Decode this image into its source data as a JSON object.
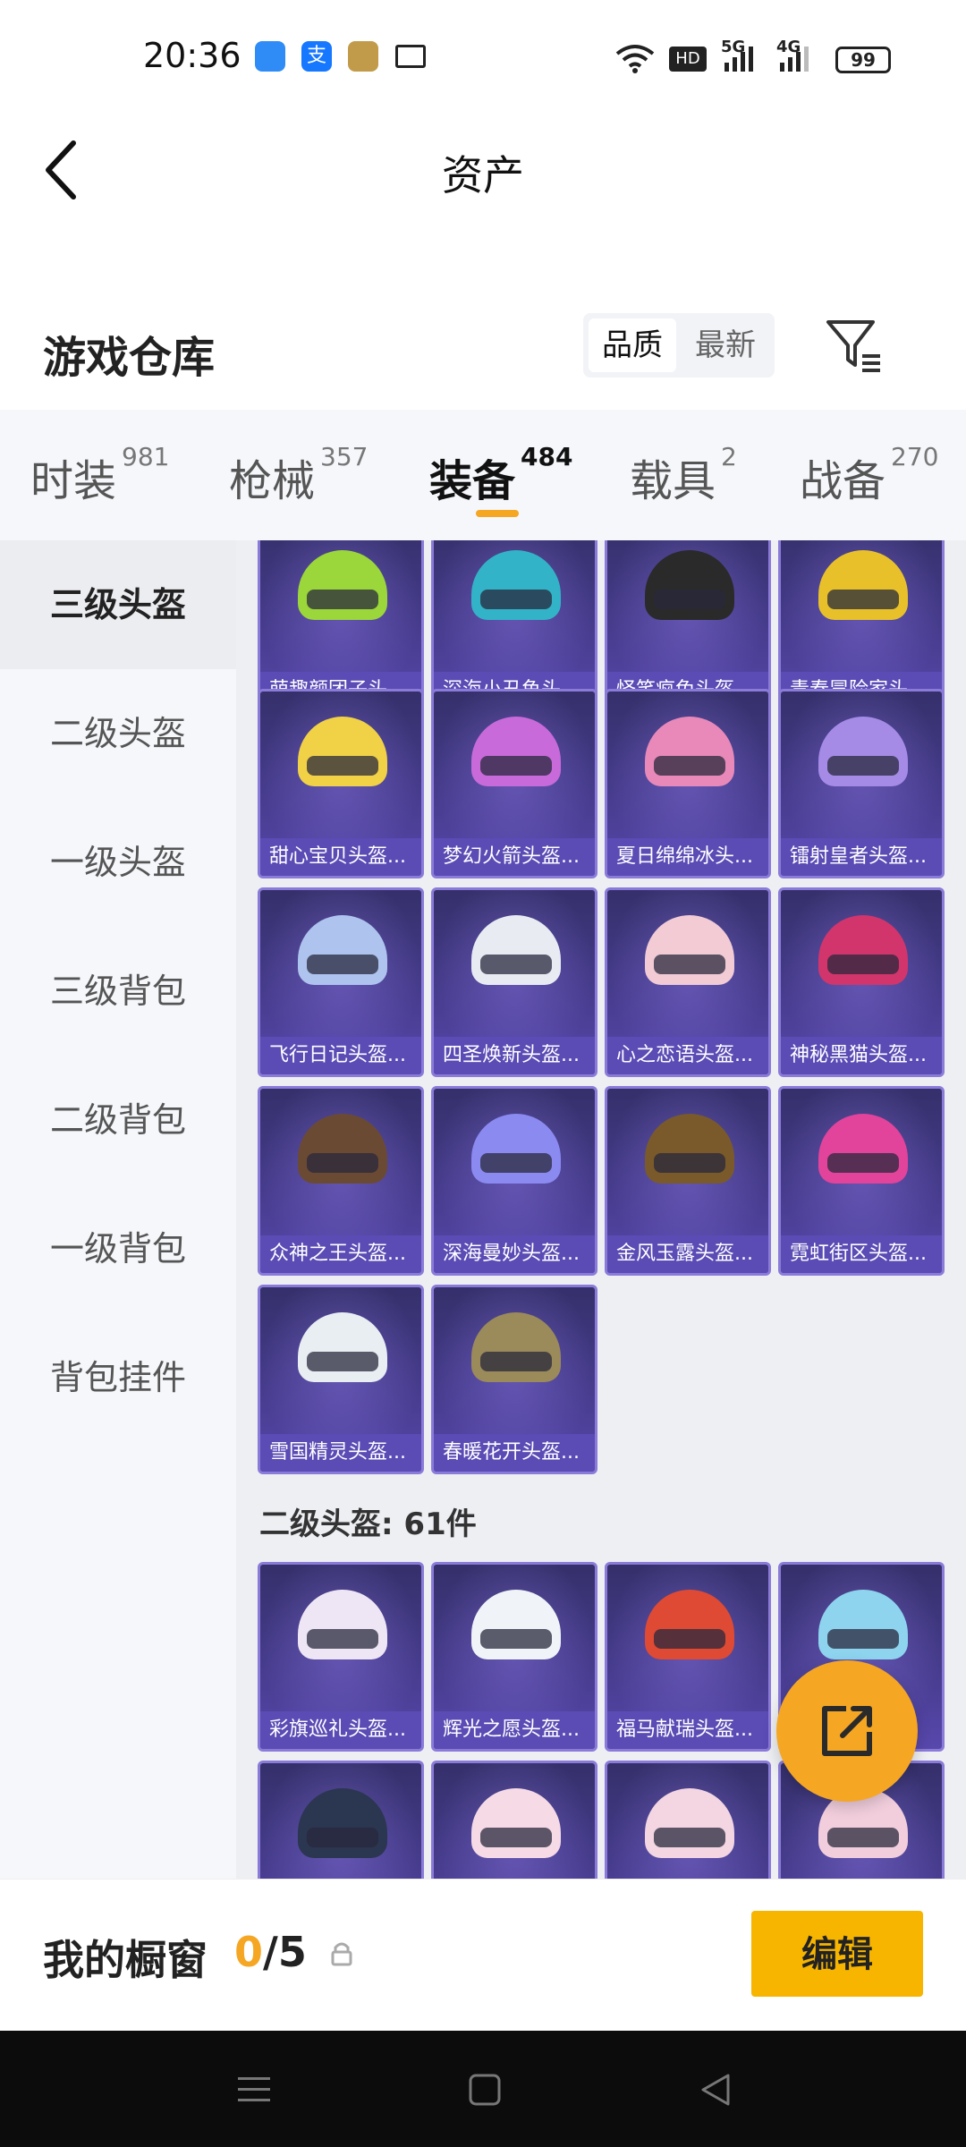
{
  "status_bar": {
    "time": "20:36",
    "icons": [
      "app-icon-blue",
      "alipay-icon",
      "game-app-icon",
      "mail-icon",
      "wifi-icon",
      "hd-icon",
      "5g-signal-icon",
      "4g-signal-icon"
    ],
    "network_5g": "5G",
    "network_4g": "4G",
    "hd": "HD",
    "battery": "99"
  },
  "header": {
    "title": "资产",
    "back_icon": "back-arrow-icon"
  },
  "section": {
    "title": "游戏仓库",
    "sort_options": [
      "品质",
      "最新"
    ],
    "sort_selected": "品质",
    "filter_icon": "filter-icon"
  },
  "tabs": [
    {
      "label": "时装",
      "count": "981"
    },
    {
      "label": "枪械",
      "count": "357"
    },
    {
      "label": "装备",
      "count": "484",
      "active": true
    },
    {
      "label": "载具",
      "count": "2"
    },
    {
      "label": "战备",
      "count": "270"
    }
  ],
  "sidebar": {
    "items": [
      "三级头盔",
      "二级头盔",
      "一级头盔",
      "三级背包",
      "二级背包",
      "一级背包",
      "背包挂件"
    ],
    "active": "三级头盔"
  },
  "items_level3": [
    {
      "name": "萌趣颜团子头...",
      "color": "#9bd63a"
    },
    {
      "name": "深海小丑鱼头...",
      "color": "#33b3c7"
    },
    {
      "name": "怪笑疯兔头盔...",
      "color": "#2a2a2a"
    },
    {
      "name": "青春冒险家头...",
      "color": "#e8c12a"
    },
    {
      "name": "甜心宝贝头盔...",
      "color": "#f1d146"
    },
    {
      "name": "梦幻火箭头盔...",
      "color": "#c86ad9"
    },
    {
      "name": "夏日绵绵冰头...",
      "color": "#e889b9"
    },
    {
      "name": "镭射皇者头盔...",
      "color": "#a58be6"
    },
    {
      "name": "飞行日记头盔...",
      "color": "#aec4ee"
    },
    {
      "name": "四圣焕新头盔...",
      "color": "#e8ecf2"
    },
    {
      "name": "心之恋语头盔...",
      "color": "#f2cbd5"
    },
    {
      "name": "神秘黑猫头盔...",
      "color": "#d1356b"
    },
    {
      "name": "众神之王头盔...",
      "color": "#6b4a34"
    },
    {
      "name": "深海曼妙头盔...",
      "color": "#8a8af0"
    },
    {
      "name": "金风玉露头盔...",
      "color": "#7a5a2a"
    },
    {
      "name": "霓虹街区头盔...",
      "color": "#e2439b"
    },
    {
      "name": "雪国精灵头盔...",
      "color": "#e9eef3"
    },
    {
      "name": "春暖花开头盔...",
      "color": "#9b8a5a"
    }
  ],
  "group_level2": {
    "title": "二级头盔: 61件",
    "items": [
      {
        "name": "彩旗巡礼头盔...",
        "color": "#efe6f5"
      },
      {
        "name": "辉光之愿头盔...",
        "color": "#f0f3f7"
      },
      {
        "name": "福马献瑞头盔...",
        "color": "#de4a34"
      },
      {
        "name": "",
        "color": "#8ed4ef"
      },
      {
        "name": "",
        "color": "#2b3650"
      },
      {
        "name": "",
        "color": "#f6dbe6"
      },
      {
        "name": "",
        "color": "#f3d6e2"
      },
      {
        "name": "",
        "color": "#f2cedc"
      }
    ]
  },
  "fab": {
    "icon": "share-external-icon"
  },
  "bottom": {
    "window_label": "我的橱窗",
    "window_current": "0",
    "window_total": "/5",
    "lock_icon": "lock-icon",
    "edit_label": "编辑"
  },
  "navbar": {
    "icons": [
      "menu-icon",
      "home-icon",
      "back-icon"
    ]
  }
}
